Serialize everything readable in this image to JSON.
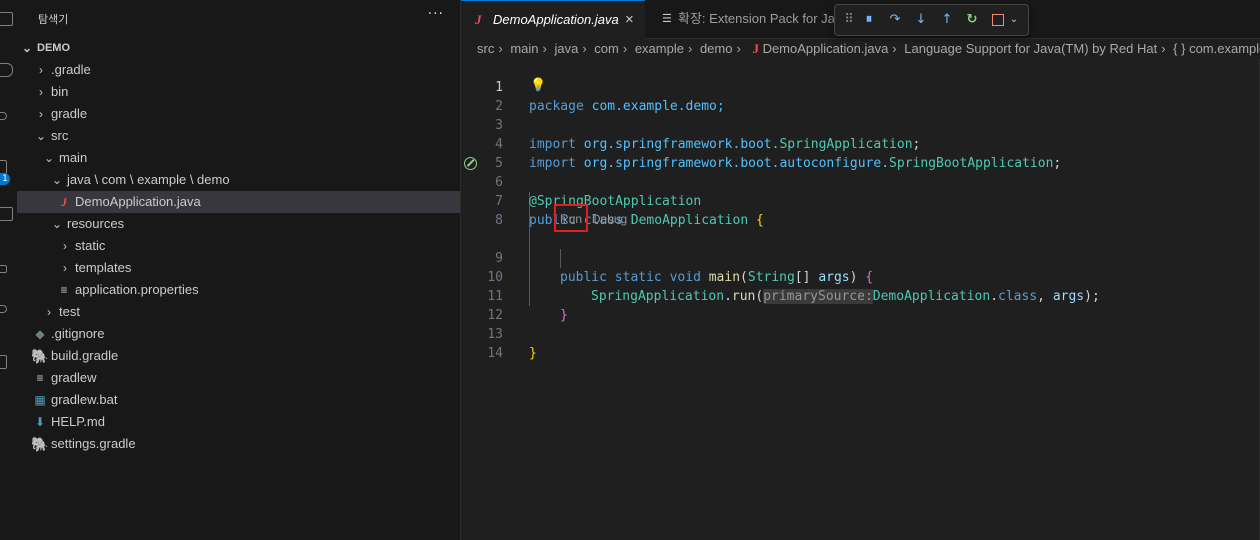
{
  "sidebar": {
    "title": "탐색기",
    "more_icon": "···",
    "root": "DEMO",
    "items": [
      {
        "label": ".gradle",
        "icon": "chevron-right"
      },
      {
        "label": "bin",
        "icon": "chevron-right"
      },
      {
        "label": "gradle",
        "icon": "chevron-right"
      },
      {
        "label": "src",
        "icon": "chevron-down"
      },
      {
        "label": "main",
        "icon": "chevron-down"
      },
      {
        "label": "java \\ com \\ example \\ demo",
        "icon": "chevron-down"
      },
      {
        "label": "DemoApplication.java",
        "icon": "java-file-icon"
      },
      {
        "label": "resources",
        "icon": "chevron-down"
      },
      {
        "label": "static",
        "icon": "chevron-right"
      },
      {
        "label": "templates",
        "icon": "chevron-right"
      },
      {
        "label": "application.properties",
        "icon": "properties-file-icon"
      },
      {
        "label": "test",
        "icon": "chevron-right"
      },
      {
        "label": ".gitignore",
        "icon": "git-icon"
      },
      {
        "label": "build.gradle",
        "icon": "gradle-elephant-icon"
      },
      {
        "label": "gradlew",
        "icon": "text-file-icon"
      },
      {
        "label": "gradlew.bat",
        "icon": "windows-icon"
      },
      {
        "label": "HELP.md",
        "icon": "markdown-arrow-icon"
      },
      {
        "label": "settings.gradle",
        "icon": "gradle-elephant-icon"
      }
    ],
    "badge": "1"
  },
  "tabs": [
    {
      "label": "DemoApplication.java",
      "icon_text": "J",
      "close": "×",
      "active": true
    },
    {
      "label": "확장: Extension Pack for Java",
      "icon_text": "☰",
      "active": false
    }
  ],
  "breadcrumb": [
    "src",
    "main",
    "java",
    "com",
    "example",
    "demo",
    "DemoApplication.java",
    "Language Support for Java(TM) by Red Hat",
    "{ } com.example"
  ],
  "codelens": {
    "run": "Run",
    "sep": " | ",
    "debug": "Debug"
  },
  "line_numbers": [
    "1",
    "2",
    "3",
    "4",
    "5",
    "6",
    "7",
    "8",
    "9",
    "10",
    "11",
    "12",
    "13",
    "14"
  ],
  "code": {
    "l1_kw": "package",
    "l1_rest": " com.example.demo;",
    "l3_kw": "import",
    "l3_pkg": " org.springframework.boot.",
    "l3_cls": "SpringApplication",
    "l3_end": ";",
    "l4_kw": "import",
    "l4_pkg": " org.springframework.boot.autoconfigure.",
    "l4_cls": "SpringBootApplication",
    "l4_end": ";",
    "l6_ann": "@SpringBootApplication",
    "l7_kw1": "public",
    "l7_kw2": " class",
    "l7_cls": " DemoApplication ",
    "l7_br": "{",
    "l9_kw1": "public",
    "l9_kw2": " static",
    "l9_kw3": " void",
    "l9_fn": " main",
    "l9_p1": "(",
    "l9_type": "String",
    "l9_arr": "[]",
    "l9_arg": " args",
    "l9_p2": ") ",
    "l9_br": "{",
    "l10_cls": "SpringApplication",
    "l10_dot": ".",
    "l10_fn": "run",
    "l10_p1": "(",
    "l10_hint": "primarySource:",
    "l10_cls2": "DemoApplication",
    "l10_dot2": ".",
    "l10_kw": "class",
    "l10_comma": ", ",
    "l10_arg": "args",
    "l10_p2": ");",
    "l11_br": "}",
    "l13_br": "}"
  },
  "debug_toolbar": [
    "drag-handle",
    "pause",
    "step-over",
    "step-into",
    "step-out",
    "restart",
    "stop"
  ]
}
